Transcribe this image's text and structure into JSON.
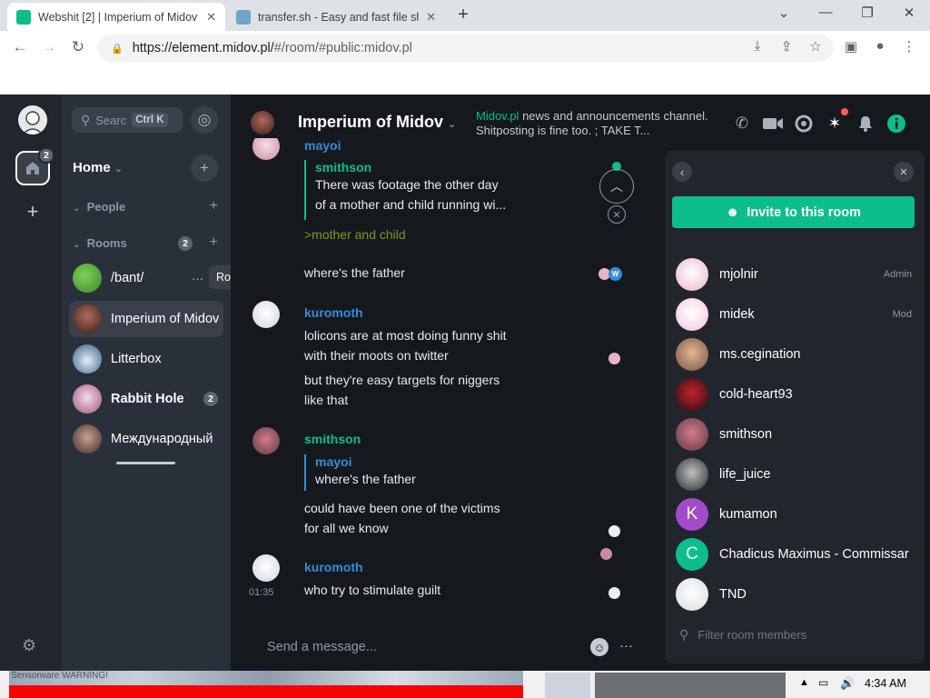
{
  "browser": {
    "tabs": [
      {
        "title": "Webshit [2] | Imperium of Midov",
        "active": true
      },
      {
        "title": "transfer.sh - Easy and fast file sharing",
        "active": false
      }
    ],
    "url_prefix": "https://element.midov.pl/",
    "url_path": "#/room/#public:midov.pl"
  },
  "spaces": {
    "home_badge": "2",
    "add_label": "+",
    "settings_icon": "gear-icon"
  },
  "room_list": {
    "search_placeholder": "Searc",
    "search_shortcut": "Ctrl K",
    "home_title": "Home",
    "sections": {
      "people": "People",
      "rooms": "Rooms"
    },
    "rooms_badge": "2",
    "tooltip": "Room options",
    "rooms": [
      {
        "name": "/bant/",
        "bold": false,
        "badge": ""
      },
      {
        "name": "Imperium of Midov",
        "bold": false,
        "badge": ""
      },
      {
        "name": "Litterbox",
        "bold": false,
        "badge": ""
      },
      {
        "name": "Rabbit Hole",
        "bold": true,
        "badge": "2"
      },
      {
        "name": "Международный",
        "bold": false,
        "badge": ""
      }
    ]
  },
  "room": {
    "title": "Imperium of Midov",
    "topic_link": "Midov.pl",
    "topic_text": " news and announcements channel. Shitposting is fine too. ; TAKE T..."
  },
  "messages": {
    "m0": {
      "sender": "mayoi"
    },
    "m1": {
      "quote_sender": "smithson",
      "quote_line1": "There was footage the other day",
      "quote_line2": "of a mother and child running wi...",
      "greentext": ">mother and child",
      "text": "where's the father"
    },
    "m2": {
      "sender": "kuromoth",
      "line1": "lolicons are at most doing funny shit",
      "line2": "with their moots on twitter",
      "line3": "but they're easy targets for niggers",
      "line4": "like that"
    },
    "m3": {
      "sender": "smithson",
      "quote_sender": "mayoi",
      "quote_text": "where's the father",
      "line1": "could have been one of the victims",
      "line2": "for all we know"
    },
    "m4": {
      "sender": "kuromoth",
      "time": "01:35",
      "text": "who try to stimulate guilt"
    }
  },
  "composer": {
    "placeholder": "Send a message..."
  },
  "members_panel": {
    "invite_label": "Invite to this room",
    "filter_placeholder": "Filter room members",
    "members": [
      {
        "name": "mjolnir",
        "role": "Admin"
      },
      {
        "name": "midek",
        "role": "Mod"
      },
      {
        "name": "ms.cegination",
        "role": ""
      },
      {
        "name": "cold-heart93",
        "role": ""
      },
      {
        "name": "smithson",
        "role": ""
      },
      {
        "name": "life_juice",
        "role": ""
      },
      {
        "name": "kumamon",
        "role": "",
        "initial": "K"
      },
      {
        "name": "Chadicus Maximus - Commissar",
        "role": "",
        "initial": "C"
      },
      {
        "name": "TND",
        "role": ""
      }
    ]
  },
  "taskbar": {
    "time": "4:34 AM",
    "sensor_text": "Sensorware WARNING!"
  },
  "colors": {
    "accent": "#0dbd8b",
    "link": "#368bd6",
    "greentext": "#789922"
  }
}
